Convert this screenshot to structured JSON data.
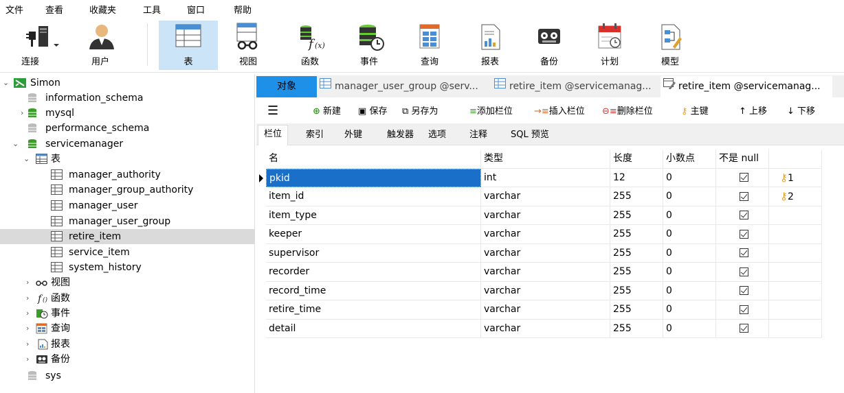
{
  "menu": [
    "文件",
    "查看",
    "收藏夹",
    "工具",
    "窗口",
    "帮助"
  ],
  "toolbar": {
    "connect": "连接",
    "user": "用户",
    "table": "表",
    "view": "视图",
    "function": "函数",
    "event": "事件",
    "query": "查询",
    "report": "报表",
    "backup": "备份",
    "schedule": "计划",
    "model": "模型"
  },
  "tree": {
    "connection": "Simon",
    "db1": "information_schema",
    "db2": "mysql",
    "db3": "performance_schema",
    "db4": "servicemanager",
    "tables_node": "表",
    "tables": [
      "manager_authority",
      "manager_group_authority",
      "manager_user",
      "manager_user_group",
      "retire_item",
      "service_item",
      "system_history"
    ],
    "views": "视图",
    "functions": "函数",
    "events": "事件",
    "queries": "查询",
    "reports": "报表",
    "backups": "备份",
    "db5": "sys"
  },
  "tabs": {
    "objects": "对象",
    "tab1": "manager_user_group @serv...",
    "tab2": "retire_item @servicemanag...",
    "tab3": "retire_item @servicemanag..."
  },
  "editor": {
    "new": "新建",
    "save": "保存",
    "save_as": "另存为",
    "add_field": "添加栏位",
    "insert_field": "插入栏位",
    "delete_field": "删除栏位",
    "primary_key": "主键",
    "move_up": "上移",
    "move_down": "下移"
  },
  "subtabs": [
    "栏位",
    "索引",
    "外键",
    "触发器",
    "选项",
    "注释",
    "SQL 预览"
  ],
  "grid": {
    "headers": [
      "名",
      "类型",
      "长度",
      "小数点",
      "不是 null",
      ""
    ],
    "rows": [
      {
        "name": "pkid",
        "type": "int",
        "length": "12",
        "decimal": "0",
        "notnull": true,
        "key": "1"
      },
      {
        "name": "item_id",
        "type": "varchar",
        "length": "255",
        "decimal": "0",
        "notnull": true,
        "key": "2"
      },
      {
        "name": "item_type",
        "type": "varchar",
        "length": "255",
        "decimal": "0",
        "notnull": true,
        "key": ""
      },
      {
        "name": "keeper",
        "type": "varchar",
        "length": "255",
        "decimal": "0",
        "notnull": true,
        "key": ""
      },
      {
        "name": "supervisor",
        "type": "varchar",
        "length": "255",
        "decimal": "0",
        "notnull": true,
        "key": ""
      },
      {
        "name": "recorder",
        "type": "varchar",
        "length": "255",
        "decimal": "0",
        "notnull": true,
        "key": ""
      },
      {
        "name": "record_time",
        "type": "varchar",
        "length": "255",
        "decimal": "0",
        "notnull": true,
        "key": ""
      },
      {
        "name": "retire_time",
        "type": "varchar",
        "length": "255",
        "decimal": "0",
        "notnull": true,
        "key": ""
      },
      {
        "name": "detail",
        "type": "varchar",
        "length": "255",
        "decimal": "0",
        "notnull": true,
        "key": ""
      }
    ]
  },
  "colors": {
    "accent": "#1e90e8",
    "selection": "#1a6fc9",
    "active_tool": "#cce4f7"
  }
}
